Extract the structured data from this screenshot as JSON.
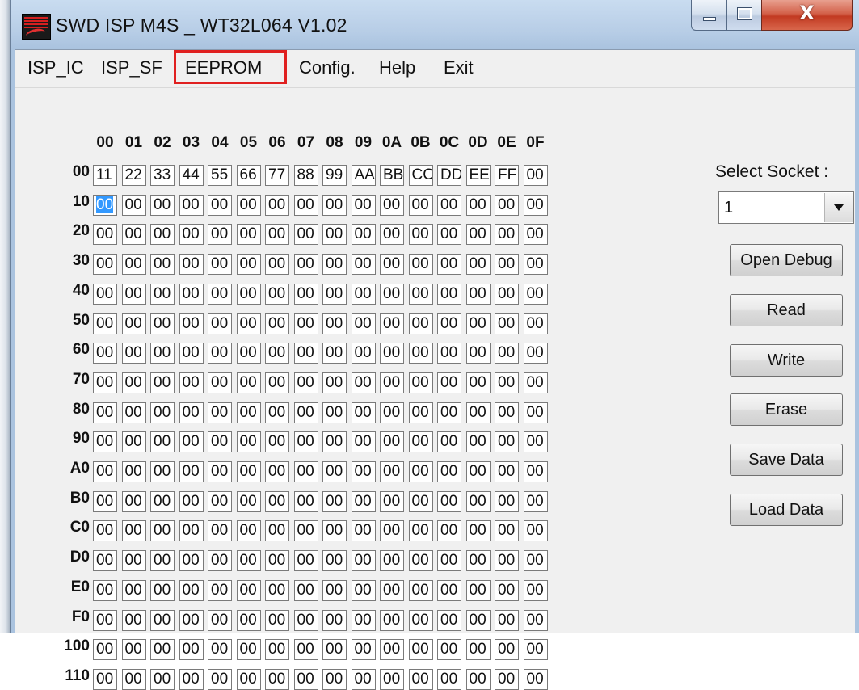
{
  "window": {
    "title": "SWD ISP M4S _ WT32L064  V1.02",
    "app_icon": "app-logo-icon",
    "controls": {
      "minimize": "minimize-icon",
      "maximize": "maximize-icon",
      "close_label": "X"
    }
  },
  "menu": {
    "items": [
      {
        "label": "ISP_IC"
      },
      {
        "label": "ISP_SF"
      },
      {
        "label": "EEPROM"
      },
      {
        "label": "Config."
      },
      {
        "label": "Help"
      },
      {
        "label": "Exit"
      }
    ],
    "highlighted": "EEPROM",
    "highlight_color": "#e02020"
  },
  "hex_grid": {
    "col_headers": [
      "00",
      "01",
      "02",
      "03",
      "04",
      "05",
      "06",
      "07",
      "08",
      "09",
      "0A",
      "0B",
      "0C",
      "0D",
      "0E",
      "0F"
    ],
    "row_headers": [
      "00",
      "10",
      "20",
      "30",
      "40",
      "50",
      "60",
      "70",
      "80",
      "90",
      "A0",
      "B0",
      "C0",
      "D0",
      "E0",
      "F0",
      "100",
      "110"
    ],
    "rows": [
      [
        "11",
        "22",
        "33",
        "44",
        "55",
        "66",
        "77",
        "88",
        "99",
        "AA",
        "BB",
        "CC",
        "DD",
        "EE",
        "FF",
        "00"
      ],
      [
        "00",
        "00",
        "00",
        "00",
        "00",
        "00",
        "00",
        "00",
        "00",
        "00",
        "00",
        "00",
        "00",
        "00",
        "00",
        "00"
      ],
      [
        "00",
        "00",
        "00",
        "00",
        "00",
        "00",
        "00",
        "00",
        "00",
        "00",
        "00",
        "00",
        "00",
        "00",
        "00",
        "00"
      ],
      [
        "00",
        "00",
        "00",
        "00",
        "00",
        "00",
        "00",
        "00",
        "00",
        "00",
        "00",
        "00",
        "00",
        "00",
        "00",
        "00"
      ],
      [
        "00",
        "00",
        "00",
        "00",
        "00",
        "00",
        "00",
        "00",
        "00",
        "00",
        "00",
        "00",
        "00",
        "00",
        "00",
        "00"
      ],
      [
        "00",
        "00",
        "00",
        "00",
        "00",
        "00",
        "00",
        "00",
        "00",
        "00",
        "00",
        "00",
        "00",
        "00",
        "00",
        "00"
      ],
      [
        "00",
        "00",
        "00",
        "00",
        "00",
        "00",
        "00",
        "00",
        "00",
        "00",
        "00",
        "00",
        "00",
        "00",
        "00",
        "00"
      ],
      [
        "00",
        "00",
        "00",
        "00",
        "00",
        "00",
        "00",
        "00",
        "00",
        "00",
        "00",
        "00",
        "00",
        "00",
        "00",
        "00"
      ],
      [
        "00",
        "00",
        "00",
        "00",
        "00",
        "00",
        "00",
        "00",
        "00",
        "00",
        "00",
        "00",
        "00",
        "00",
        "00",
        "00"
      ],
      [
        "00",
        "00",
        "00",
        "00",
        "00",
        "00",
        "00",
        "00",
        "00",
        "00",
        "00",
        "00",
        "00",
        "00",
        "00",
        "00"
      ],
      [
        "00",
        "00",
        "00",
        "00",
        "00",
        "00",
        "00",
        "00",
        "00",
        "00",
        "00",
        "00",
        "00",
        "00",
        "00",
        "00"
      ],
      [
        "00",
        "00",
        "00",
        "00",
        "00",
        "00",
        "00",
        "00",
        "00",
        "00",
        "00",
        "00",
        "00",
        "00",
        "00",
        "00"
      ],
      [
        "00",
        "00",
        "00",
        "00",
        "00",
        "00",
        "00",
        "00",
        "00",
        "00",
        "00",
        "00",
        "00",
        "00",
        "00",
        "00"
      ],
      [
        "00",
        "00",
        "00",
        "00",
        "00",
        "00",
        "00",
        "00",
        "00",
        "00",
        "00",
        "00",
        "00",
        "00",
        "00",
        "00"
      ],
      [
        "00",
        "00",
        "00",
        "00",
        "00",
        "00",
        "00",
        "00",
        "00",
        "00",
        "00",
        "00",
        "00",
        "00",
        "00",
        "00"
      ],
      [
        "00",
        "00",
        "00",
        "00",
        "00",
        "00",
        "00",
        "00",
        "00",
        "00",
        "00",
        "00",
        "00",
        "00",
        "00",
        "00"
      ],
      [
        "00",
        "00",
        "00",
        "00",
        "00",
        "00",
        "00",
        "00",
        "00",
        "00",
        "00",
        "00",
        "00",
        "00",
        "00",
        "00"
      ],
      [
        "00",
        "00",
        "00",
        "00",
        "00",
        "00",
        "00",
        "00",
        "00",
        "00",
        "00",
        "00",
        "00",
        "00",
        "00",
        "00"
      ]
    ],
    "focused_cell": {
      "row": 1,
      "col": 0
    }
  },
  "side_panel": {
    "socket_label": "Select Socket :",
    "socket_value": "1",
    "buttons": [
      {
        "name": "open-debug-button",
        "label": "Open Debug"
      },
      {
        "name": "read-button",
        "label": "Read"
      },
      {
        "name": "write-button",
        "label": "Write"
      },
      {
        "name": "erase-button",
        "label": "Erase"
      },
      {
        "name": "save-data-button",
        "label": "Save Data"
      },
      {
        "name": "load-data-button",
        "label": "Load Data"
      }
    ]
  }
}
